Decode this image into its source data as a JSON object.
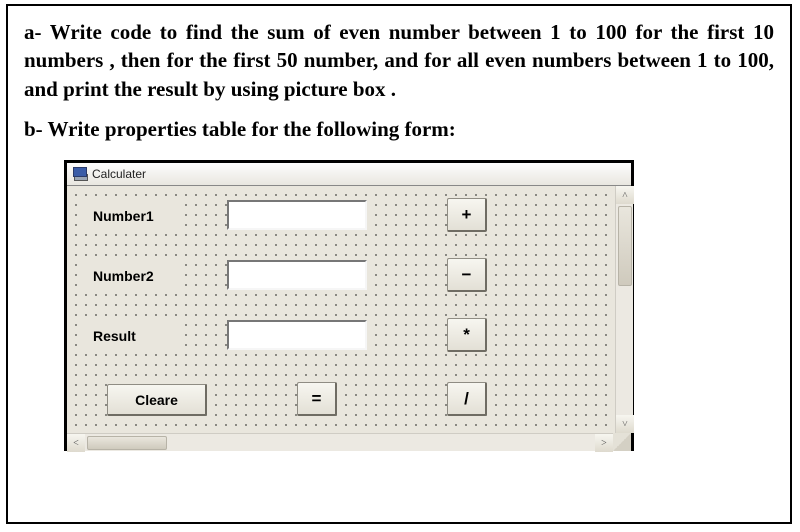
{
  "question_a": "a- Write code to find the sum of even number between 1 to 100  for the first 10 numbers , then for the first 50 number, and for all even numbers between 1 to 100, and print the result by using picture box .",
  "question_b": "b-  Write properties table for the following form:",
  "form": {
    "title": "Calculater",
    "labels": {
      "num1": "Number1",
      "num2": "Number2",
      "result": "Result"
    },
    "buttons": {
      "plus": "+",
      "minus": "−",
      "mult": "*",
      "div": "/",
      "equals": "=",
      "cleare": "Cleare"
    },
    "inputs": {
      "num1": "",
      "num2": "",
      "result": ""
    }
  }
}
